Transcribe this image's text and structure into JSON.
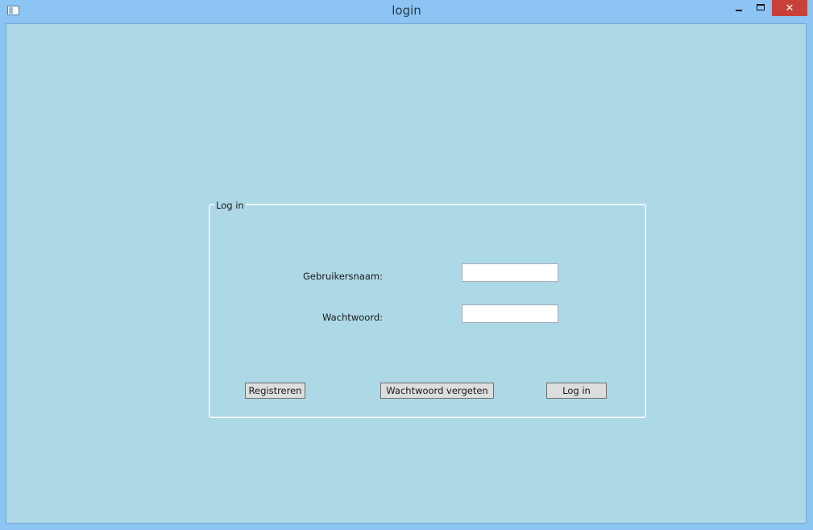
{
  "window": {
    "title": "login",
    "app_icon": "window-app-icon",
    "controls": {
      "minimize_icon": "minimize-icon",
      "maximize_icon": "maximize-icon",
      "close_glyph": "✕"
    }
  },
  "login_group": {
    "legend": "Log in",
    "username_label": "Gebruikersnaam:",
    "username_value": "",
    "password_label": "Wachtwoord:",
    "password_value": "",
    "buttons": {
      "register": "Registreren",
      "forgot_password": "Wachtwoord vergeten",
      "login": "Log in"
    }
  },
  "colors": {
    "window_frame": "#8cc4f4",
    "client_background": "#add8e6",
    "close_button": "#c7413a",
    "button_background": "#dddddd"
  }
}
